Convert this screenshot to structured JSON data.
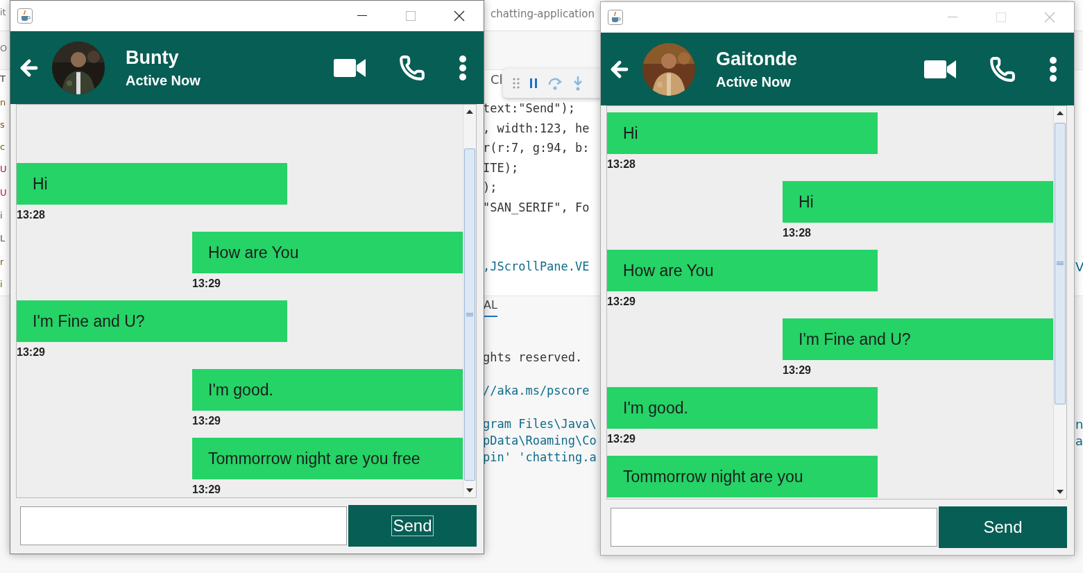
{
  "background": {
    "title": "chatting-application",
    "tab_fragment": "Cl",
    "code_lines": [
      "text:\"Send\");",
      ", width:123, he",
      "r(r:7, g:94, b:",
      "ITE);",
      ");",
      "\"SAN_SERIF\", Fo",
      ",JScrollPane.VE"
    ],
    "panel_tab": "AL",
    "terminal_lines": [
      "ghts reserved.",
      "//aka.ms/pscore",
      "gram Files\\Java\\",
      "pData\\Roaming\\Co",
      "pin' 'chatting.a"
    ],
    "left_fragments": [
      "it",
      "O",
      "T",
      "n",
      "s",
      "c",
      "U",
      "U",
      "i",
      "L",
      "r",
      "i"
    ],
    "right_fragments": [
      "V",
      "n",
      "a"
    ]
  },
  "windows": [
    {
      "active": true,
      "contact": {
        "name": "Bunty",
        "status": "Active Now"
      },
      "messages": [
        {
          "kind": "received",
          "text": "Hi",
          "time": "13:28"
        },
        {
          "kind": "sent",
          "text": "How are You",
          "time": "13:29"
        },
        {
          "kind": "received",
          "text": "I'm Fine and U?",
          "time": "13:29"
        },
        {
          "kind": "sent",
          "text": "I'm good.",
          "time": "13:29"
        },
        {
          "kind": "sent",
          "text": "Tommorrow night are you free",
          "time": "13:29"
        }
      ],
      "send": {
        "label": "Send",
        "focused": true
      }
    },
    {
      "active": false,
      "contact": {
        "name": "Gaitonde",
        "status": "Active Now"
      },
      "messages": [
        {
          "kind": "received",
          "text": "Hi",
          "time": "13:28"
        },
        {
          "kind": "sent",
          "text": "Hi",
          "time": "13:28"
        },
        {
          "kind": "received",
          "text": "How are You",
          "time": "13:29"
        },
        {
          "kind": "sent",
          "text": "I'm Fine and U?",
          "time": "13:29"
        },
        {
          "kind": "received",
          "text": "I'm good.",
          "time": "13:29"
        },
        {
          "kind": "received",
          "text": "Tommorrow night are you"
        }
      ],
      "send": {
        "label": "Send",
        "focused": false
      }
    }
  ]
}
